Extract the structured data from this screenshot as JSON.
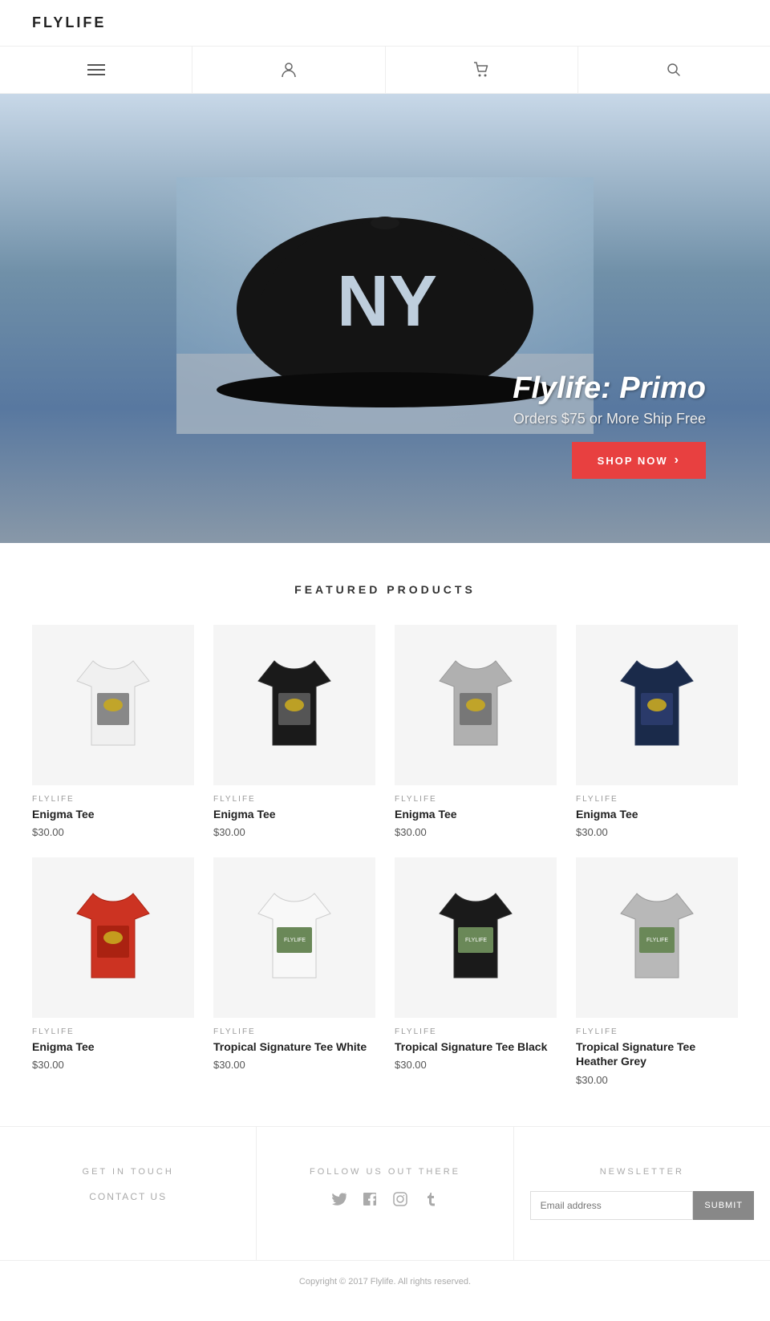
{
  "header": {
    "logo": "FLYLIFE"
  },
  "nav": {
    "items": [
      {
        "icon": "≡",
        "label": "menu-icon"
      },
      {
        "icon": "👤",
        "label": "account-icon"
      },
      {
        "icon": "🛒",
        "label": "cart-icon"
      },
      {
        "icon": "🔍",
        "label": "search-icon"
      }
    ]
  },
  "hero": {
    "cap_text": "NY",
    "title": "Flylife: Primo",
    "subtitle": "Orders $75 or More Ship Free",
    "button_label": "ShOP NOW",
    "button_arrow": "›"
  },
  "featured": {
    "section_title": "FEATURED PRODUCTS",
    "products": [
      {
        "brand": "FLYLIFE",
        "name": "Enigma Tee",
        "price": "$30.00",
        "color": "#ffffff",
        "stroke": "#ccc",
        "row": 1
      },
      {
        "brand": "FLYLIFE",
        "name": "Enigma Tee",
        "price": "$30.00",
        "color": "#1a1a1a",
        "stroke": "#333",
        "row": 1
      },
      {
        "brand": "FLYLIFE",
        "name": "Enigma Tee",
        "price": "$30.00",
        "color": "#b0b0b0",
        "stroke": "#999",
        "row": 1
      },
      {
        "brand": "FLYLIFE",
        "name": "Enigma Tee",
        "price": "$30.00",
        "color": "#1a2a4a",
        "stroke": "#2a3a5a",
        "row": 1
      },
      {
        "brand": "FLYLIFE",
        "name": "Enigma Tee",
        "price": "$30.00",
        "color": "#cc3322",
        "stroke": "#aa2211",
        "row": 2
      },
      {
        "brand": "FLYLIFE",
        "name": "Tropical Signature Tee White",
        "price": "$30.00",
        "color": "#ffffff",
        "stroke": "#ccc",
        "row": 2
      },
      {
        "brand": "FLYLIFE",
        "name": "Tropical Signature Tee Black",
        "price": "$30.00",
        "color": "#1a1a1a",
        "stroke": "#333",
        "row": 2
      },
      {
        "brand": "FLYLIFE",
        "name": "Tropical Signature Tee Heather Grey",
        "price": "$30.00",
        "color": "#b8b8b8",
        "stroke": "#999",
        "row": 2
      }
    ]
  },
  "footer": {
    "col1": {
      "heading": "GET IN TOUCH",
      "link": "CONTACT US"
    },
    "col2": {
      "heading": "FOLLOW US OUT THERE",
      "social": [
        "🐦",
        "f",
        "📷",
        "t"
      ]
    },
    "col3": {
      "heading": "NEWSLETTER",
      "placeholder": "Email address",
      "button": "SUBMIT"
    },
    "copyright": "Copyright © 2017 Flylife. All rights reserved."
  }
}
